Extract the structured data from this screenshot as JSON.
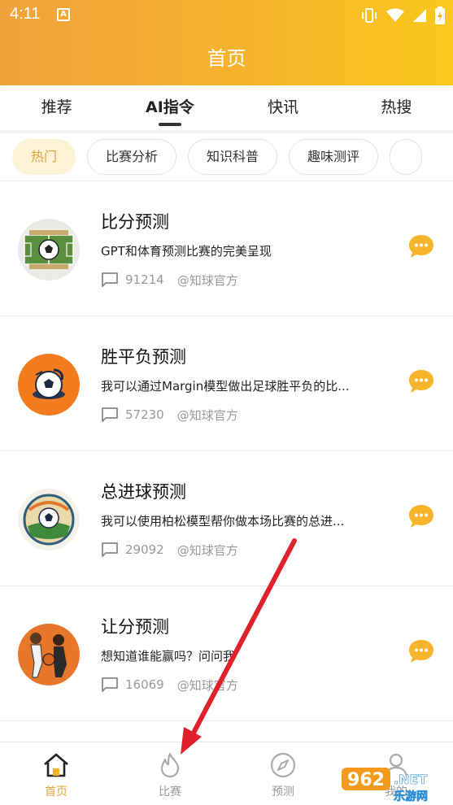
{
  "status_bar": {
    "time": "4:11",
    "notification_glyph": "A"
  },
  "header": {
    "title": "首页"
  },
  "tabs": [
    {
      "label": "推荐",
      "active": false
    },
    {
      "label": "AI指令",
      "active": true
    },
    {
      "label": "快讯",
      "active": false
    },
    {
      "label": "热搜",
      "active": false
    }
  ],
  "chips": [
    {
      "label": "热门",
      "active": true
    },
    {
      "label": "比赛分析",
      "active": false
    },
    {
      "label": "知识科普",
      "active": false
    },
    {
      "label": "趣味测评",
      "active": false
    }
  ],
  "items": [
    {
      "title": "比分预测",
      "desc": "GPT和体育预测比赛的完美呈现",
      "count": "91214",
      "author": "@知球官方",
      "avatar_icon": "soccer-field-icon"
    },
    {
      "title": "胜平负预测",
      "desc": "我可以通过Margin模型做出足球胜平负的比...",
      "count": "57230",
      "author": "@知球官方",
      "avatar_icon": "soccer-ball-icon"
    },
    {
      "title": "总进球预测",
      "desc": "我可以使用柏松模型帮你做本场比赛的总进...",
      "count": "29092",
      "author": "@知球官方",
      "avatar_icon": "stadium-ball-icon"
    },
    {
      "title": "让分预测",
      "desc": "想知道谁能赢吗？问问我",
      "count": "16069",
      "author": "@知球官方",
      "avatar_icon": "basketball-players-icon"
    }
  ],
  "bottom_nav": [
    {
      "label": "首页",
      "icon": "home-icon",
      "active": true
    },
    {
      "label": "比赛",
      "icon": "flame-icon",
      "active": false
    },
    {
      "label": "预测",
      "icon": "compass-icon",
      "active": false
    },
    {
      "label": "我的",
      "icon": "profile-icon",
      "active": false
    }
  ],
  "watermark": {
    "text": "962",
    "suffix": ".NET",
    "sub": "乐游网"
  },
  "colors": {
    "header_start": "#f1a13c",
    "header_end": "#fbc81c",
    "accent": "#e3a43a",
    "chat_yellow": "#f7b52c",
    "arrow_red": "#e0202a"
  }
}
